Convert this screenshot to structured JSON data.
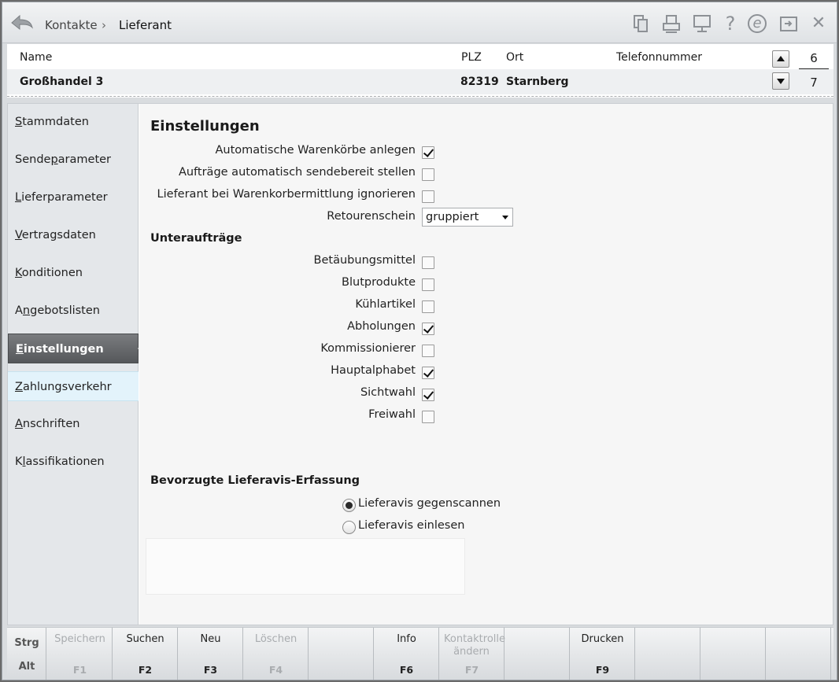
{
  "titlebar": {
    "breadcrumb": [
      "Kontakte",
      "›",
      "Lieferant"
    ],
    "icons": [
      "documents-icon",
      "printer-icon",
      "monitor-icon",
      "help-icon",
      "e-icon",
      "window-switch-icon",
      "close-icon"
    ],
    "help_glyph": "?",
    "e_glyph": "e",
    "close_glyph": "✕"
  },
  "list": {
    "headers": {
      "name": "Name",
      "plz": "PLZ",
      "ort": "Ort",
      "telefon": "Telefonnummer"
    },
    "row": {
      "name": "Großhandel 3",
      "plz": "82319",
      "ort": "Starnberg",
      "telefon": ""
    },
    "count_top": "6",
    "count_bottom": "7"
  },
  "sidebar": {
    "items": [
      {
        "first": "S",
        "rest": "tammdaten"
      },
      {
        "pre": "Sende",
        "u": "p",
        "post": "arameter"
      },
      {
        "first": "L",
        "rest": "ieferparameter"
      },
      {
        "first": "V",
        "rest": "ertragsdaten"
      },
      {
        "first": "K",
        "rest": "onditionen"
      },
      {
        "pre": "A",
        "u": "n",
        "post": "gebotslisten"
      },
      {
        "first": "E",
        "rest": "instellungen"
      },
      {
        "first": "Z",
        "rest": "ahlungsverkehr"
      },
      {
        "first": "A",
        "rest": "nschriften"
      },
      {
        "pre": "K",
        "u": "l",
        "post": "assifikationen"
      }
    ],
    "active_index": 6
  },
  "settings": {
    "title": "Einstellungen",
    "options": [
      {
        "label": "Automatische Warenkörbe anlegen",
        "checked": true
      },
      {
        "label": "Aufträge automatisch sendebereit stellen",
        "checked": false
      },
      {
        "label": "Lieferant bei Warenkorbermittlung ignorieren",
        "checked": false
      }
    ],
    "retour_label": "Retourenschein",
    "retour_value": "gruppiert",
    "sub_title": "Unteraufträge",
    "sub_options": [
      {
        "label": "Betäubungsmittel",
        "checked": false
      },
      {
        "label": "Blutprodukte",
        "checked": false
      },
      {
        "label": "Kühlartikel",
        "checked": false
      },
      {
        "label": "Abholungen",
        "checked": true
      },
      {
        "label": "Kommissionierer",
        "checked": false
      },
      {
        "label": "Hauptalphabet",
        "checked": true
      },
      {
        "label": "Sichtwahl",
        "checked": true
      },
      {
        "label": "Freiwahl",
        "checked": false
      }
    ],
    "lieferavis_title": "Bevorzugte  Lieferavis-Erfassung",
    "lieferavis_options": [
      {
        "label": "Lieferavis gegenscannen",
        "checked": true
      },
      {
        "label": "Lieferavis einlesen",
        "checked": false
      }
    ]
  },
  "fkeys": {
    "modifiers": [
      "Strg",
      "Alt"
    ],
    "keys": [
      {
        "label": "Speichern",
        "key": "F1",
        "enabled": false
      },
      {
        "label": "Suchen",
        "key": "F2",
        "enabled": true
      },
      {
        "label": "Neu",
        "key": "F3",
        "enabled": true
      },
      {
        "label": "Löschen",
        "key": "F4",
        "enabled": false
      },
      {
        "label": "",
        "key": "",
        "enabled": false
      },
      {
        "label": "Info",
        "key": "F6",
        "enabled": true
      },
      {
        "label": "Kontaktrolle ändern",
        "key": "F7",
        "enabled": false
      },
      {
        "label": "",
        "key": "",
        "enabled": false
      },
      {
        "label": "Drucken",
        "key": "F9",
        "enabled": true
      },
      {
        "label": "",
        "key": "",
        "enabled": false
      },
      {
        "label": "",
        "key": "",
        "enabled": false
      },
      {
        "label": "",
        "key": "",
        "enabled": false
      }
    ]
  }
}
